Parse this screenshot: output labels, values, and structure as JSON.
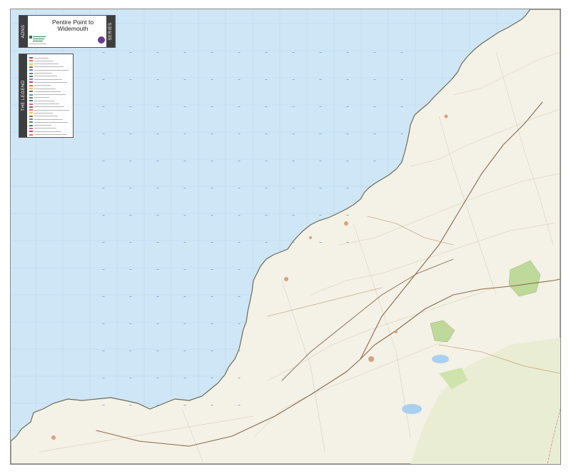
{
  "map": {
    "title_line1": "Pentire Point to",
    "title_line2": "Widemouth",
    "series_left": "ADNS",
    "series_right": "SERIES",
    "legend_side": "THE LEGEND",
    "colors": {
      "sea": "#cfe6f6",
      "land": "#f4f1e6",
      "moor": "#e9edd3",
      "woodland": "#bfd99a",
      "a_road": "#8b6a4a",
      "coast": "#6b6b5a"
    }
  }
}
